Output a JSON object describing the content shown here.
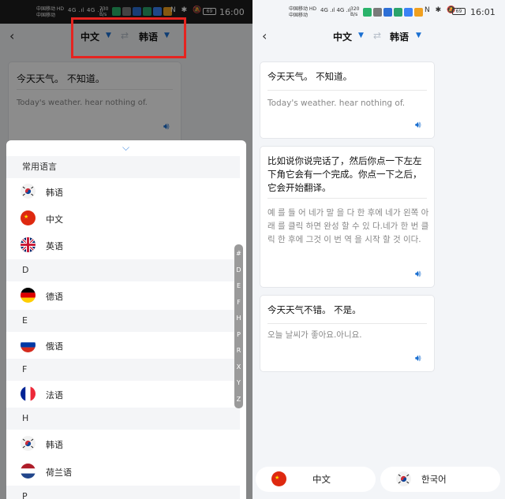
{
  "left": {
    "status": {
      "carrier": [
        "中国移动 HD",
        "中国移动"
      ],
      "net": "4G .ıl 4G .ıl",
      "speed": [
        "730",
        "B/s"
      ],
      "sys": "N ✱ 🔕",
      "battery": "69",
      "clock": "16:00"
    },
    "header": {
      "source_lang": "中文",
      "target_lang": "韩语"
    },
    "card": {
      "source": "今天天气。 不知道。",
      "target": "Today's weather. hear nothing of."
    },
    "sheet": {
      "common_title": "常用语言",
      "common": [
        {
          "flag": "kr",
          "name": "韩语"
        },
        {
          "flag": "cn",
          "name": "中文"
        },
        {
          "flag": "uk",
          "name": "英语"
        }
      ],
      "groups": [
        {
          "letter": "D",
          "items": [
            {
              "flag": "de",
              "name": "德语"
            }
          ]
        },
        {
          "letter": "E",
          "items": [
            {
              "flag": "ru",
              "name": "俄语"
            }
          ]
        },
        {
          "letter": "F",
          "items": [
            {
              "flag": "fr",
              "name": "法语"
            }
          ]
        },
        {
          "letter": "H",
          "items": [
            {
              "flag": "kr",
              "name": "韩语"
            },
            {
              "flag": "nl",
              "name": "荷兰语"
            }
          ]
        },
        {
          "letter": "P",
          "items": []
        }
      ],
      "index": [
        "#",
        "D",
        "E",
        "F",
        "H",
        "P",
        "R",
        "X",
        "Y",
        "Z"
      ]
    }
  },
  "right": {
    "status": {
      "carrier": [
        "中国移动 HD",
        "中国移动"
      ],
      "net": "4G .ıl 4G .ıl",
      "speed": [
        "320",
        "B/s"
      ],
      "sys": "N ✱ 🔕",
      "battery": "69",
      "clock": "16:01"
    },
    "header": {
      "source_lang": "中文",
      "target_lang": "韩语"
    },
    "cards": [
      {
        "source": "今天天气。 不知道。",
        "target": "Today's weather. hear nothing of."
      },
      {
        "source": "比如说你说完话了，然后你点一下左左下角它会有一个完成。你点一下之后，它会开始翻译。",
        "target": "예 를 들 어 네가 말 을 다 한 후에 네가 왼쪽 아래 를 클릭 하면 완성 할 수 있 다.네가 한 번 클릭 한 후에 그것 이 번 역 을 시작 할 것 이다."
      },
      {
        "source": "今天天气不错。 不是。",
        "target": "오늘 날씨가 좋아요.아니요."
      }
    ],
    "bottom": {
      "left_label": "中文",
      "right_label": "한국어"
    }
  },
  "colors": {
    "accent": "#1a6fd1",
    "highlight": "#e52420"
  }
}
